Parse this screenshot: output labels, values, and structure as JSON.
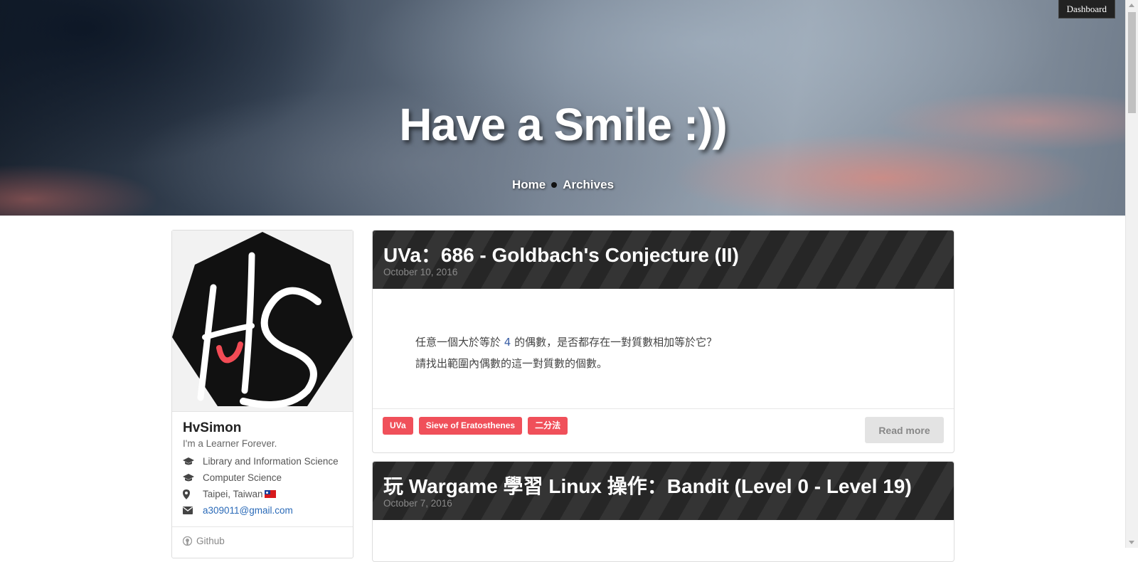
{
  "hero": {
    "title": "Have a Smile :))",
    "nav": [
      {
        "label": "Home"
      },
      {
        "label": "Archives"
      }
    ]
  },
  "dashboard": {
    "label": "Dashboard"
  },
  "sidebar": {
    "name": "HvSimon",
    "motto": "I'm a Learner Forever.",
    "info": [
      {
        "icon": "graduation-cap-icon",
        "text": "Library and Information Science"
      },
      {
        "icon": "graduation-cap-icon",
        "text": "Computer Science"
      },
      {
        "icon": "map-marker-icon",
        "text": "Taipei, Taiwan"
      },
      {
        "icon": "envelope-icon",
        "text": "a309011@gmail.com"
      }
    ],
    "links": [
      {
        "icon": "github-icon",
        "label": "Github"
      }
    ]
  },
  "posts": [
    {
      "title": "UVa：686 - Goldbach's Conjecture (II)",
      "date": "October 10, 2016",
      "excerpt_line1_pre": "任意一個大於等於 ",
      "excerpt_line1_num": "4",
      "excerpt_line1_post": " 的偶數，是否都存在一對質數相加等於它？",
      "excerpt_line2": "請找出範圍內偶數的這一對質數的個數。",
      "tags": [
        "UVa",
        "Sieve of Eratosthenes",
        "二分法"
      ],
      "read_more": "Read more"
    },
    {
      "title": "玩 Wargame 學習 Linux 操作：Bandit (Level 0 - Level 19)",
      "date": "October 7, 2016"
    }
  ],
  "colors": {
    "tag_bg": "#f0505a",
    "header_stripe_dark": "#262626",
    "header_stripe_light": "#343434",
    "link": "#2a6ab8"
  }
}
